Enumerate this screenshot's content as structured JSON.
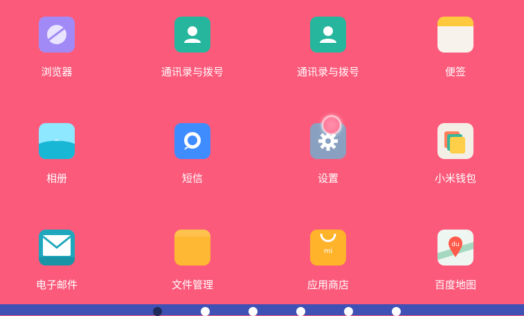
{
  "apps": [
    {
      "name": "浏览器",
      "icon": "browser-icon",
      "color": "#a68cf7"
    },
    {
      "name": "通讯录与拨号",
      "icon": "contacts-icon",
      "color": "#26b59d"
    },
    {
      "name": "通讯录与拨号",
      "icon": "contacts-icon",
      "color": "#26b59d"
    },
    {
      "name": "便签",
      "icon": "notes-icon",
      "color": "#ffc83d"
    },
    {
      "name": "相册",
      "icon": "gallery-icon",
      "color": "#2fc6e8"
    },
    {
      "name": "短信",
      "icon": "messages-icon",
      "color": "#3f8cff"
    },
    {
      "name": "设置",
      "icon": "settings-icon",
      "color": "#8aa0c0"
    },
    {
      "name": "小米钱包",
      "icon": "wallet-icon",
      "color": "#f4efe6"
    },
    {
      "name": "电子邮件",
      "icon": "mail-icon",
      "color": "#1fa7bd"
    },
    {
      "name": "文件管理",
      "icon": "folder-icon",
      "color": "#ffb833"
    },
    {
      "name": "应用商店",
      "icon": "app-store-icon",
      "color": "#ffb32b"
    },
    {
      "name": "百度地图",
      "icon": "map-icon",
      "color": "#eef6f2"
    }
  ],
  "pager": {
    "total": 6,
    "active_index": 0
  },
  "colors": {
    "background": "#fc5a7b",
    "dock": "#3f51b5"
  }
}
